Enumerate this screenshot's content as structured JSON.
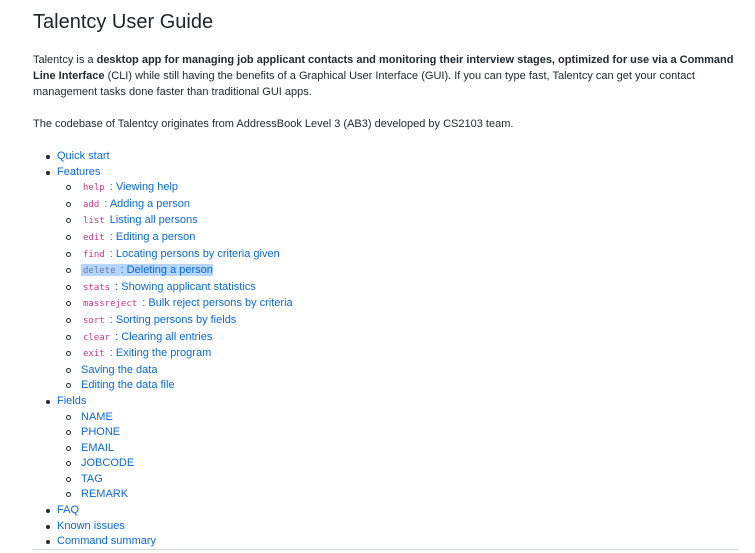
{
  "title": "Talentcy User Guide",
  "intro": {
    "p1_a": "Talentcy is a ",
    "p1_b": "desktop app for managing job applicant contacts and monitoring their interview stages, optimized for use via a Command Line Interface",
    "p1_c": " (CLI) while still having the benefits of a Graphical User Interface (GUI). If you can type fast, Talentcy can get your contact management tasks done faster than traditional GUI apps.",
    "p2": "The codebase of Talentcy originates from AddressBook Level 3 (AB3) developed by CS2103 team."
  },
  "toc": {
    "quick_start": "Quick start",
    "features": "Features",
    "features_items": [
      {
        "cmd": "help",
        "label": " : Viewing help"
      },
      {
        "cmd": "add",
        "label": " : Adding a person"
      },
      {
        "cmd": "list",
        "label": " Listing all persons"
      },
      {
        "cmd": "edit",
        "label": " : Editing a person"
      },
      {
        "cmd": "find",
        "label": " : Locating persons by criteria given"
      },
      {
        "cmd": "delete",
        "label": " : Deleting a person"
      },
      {
        "cmd": "stats",
        "label": " : Showing applicant statistics"
      },
      {
        "cmd": "massreject",
        "label": " : Bulk reject persons by criteria"
      },
      {
        "cmd": "sort",
        "label": " : Sorting persons by fields"
      },
      {
        "cmd": "clear",
        "label": " : Clearing all entries"
      },
      {
        "cmd": "exit",
        "label": " : Exiting the program"
      }
    ],
    "saving": "Saving the data",
    "editing_file": "Editing the data file",
    "fields": "Fields",
    "fields_items": [
      "NAME",
      "PHONE",
      "EMAIL",
      "JOBCODE",
      "TAG",
      "REMARK"
    ],
    "faq": "FAQ",
    "known_issues": "Known issues",
    "command_summary": "Command summary"
  },
  "colors": {
    "link": "#0969da",
    "code": "#d63384",
    "selection": "#b4d5fe"
  }
}
